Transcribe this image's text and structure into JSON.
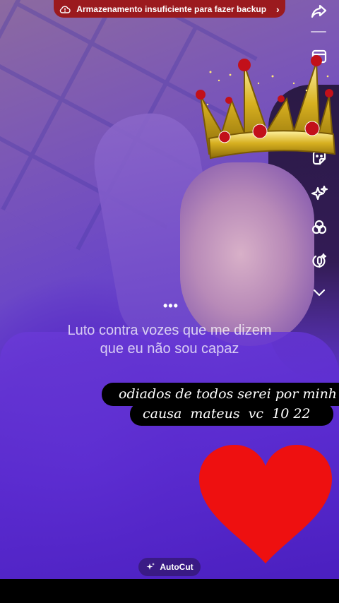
{
  "banner": {
    "text": "Armazenamento insuficiente para fazer backup",
    "icon": "cloud-warning-icon",
    "color": "#9b1a1e"
  },
  "side_rail": {
    "icons": [
      "share-arrow-icon",
      "template-icon",
      "sticker-icon",
      "effects-sparkle-icon",
      "filters-circles-icon",
      "voice-effect-icon",
      "chevron-down-icon"
    ]
  },
  "overlay": {
    "dots": "•••",
    "lyrics_line1": "Luto contra vozes que me dizem",
    "lyrics_line2": "que eu não sou capaz"
  },
  "caption": {
    "line1": "odiados de todos serei por minh",
    "line2": "causa  mateus  vc  10 22"
  },
  "stickers": [
    "crown-sticker",
    "heart-sticker"
  ],
  "autocut": {
    "label": "AutoCut",
    "icon": "sparkle-icon"
  }
}
